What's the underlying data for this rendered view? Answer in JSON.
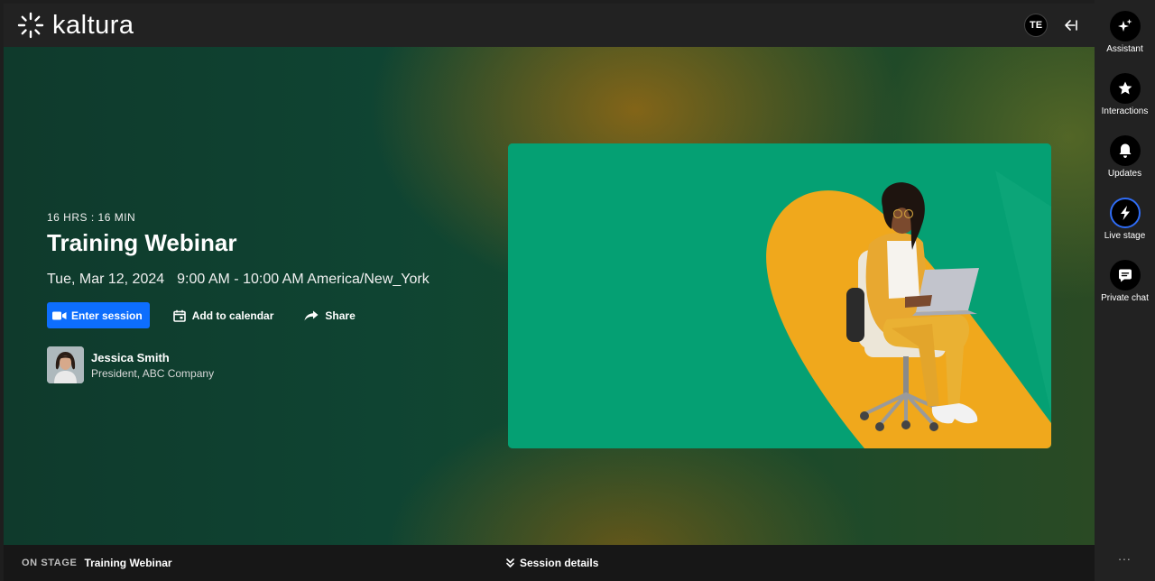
{
  "header": {
    "brand": "kaltura",
    "user_initials": "TE"
  },
  "event": {
    "countdown": "16 HRS : 16 MIN",
    "title": "Training Webinar",
    "date": "Tue, Mar 12, 2024",
    "time": "9:00 AM - 10:00 AM America/New_York",
    "actions": {
      "enter": "Enter session",
      "calendar": "Add to calendar",
      "share": "Share"
    },
    "speaker": {
      "name": "Jessica Smith",
      "title": "President, ABC Company"
    }
  },
  "bottom": {
    "on_stage_label": "ON STAGE",
    "on_stage_title": "Training Webinar",
    "session_details": "Session details"
  },
  "rail": {
    "items": [
      {
        "label": "Assistant",
        "icon": "sparkle-icon"
      },
      {
        "label": "Interactions",
        "icon": "star-icon"
      },
      {
        "label": "Updates",
        "icon": "bell-icon"
      },
      {
        "label": "Live stage",
        "icon": "lightning-icon"
      },
      {
        "label": "Private chat",
        "icon": "chat-icon"
      }
    ],
    "more": "..."
  },
  "colors": {
    "primary": "#0d6efd",
    "active_ring": "#2f6cf5",
    "banner_green": "#05a073",
    "banner_yellow": "#f0a81c"
  }
}
